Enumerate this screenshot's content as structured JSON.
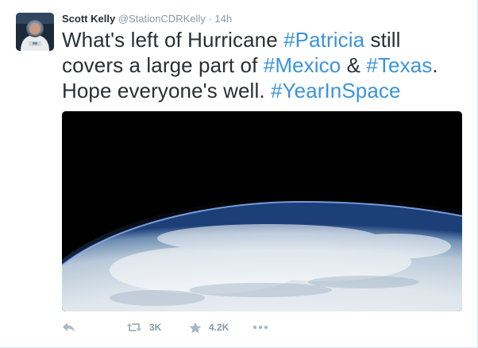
{
  "tweet": {
    "author_name": "Scott Kelly",
    "handle": "@StationCDRKelly",
    "separator": "·",
    "timestamp": "14h",
    "text": {
      "seg1": "What's left of Hurricane ",
      "tag1": "#Patricia",
      "seg2": " still covers a large part of ",
      "tag2": "#Mexico",
      "seg3": " & ",
      "tag3": "#Texas",
      "seg4": ". Hope everyone's well. ",
      "tag4": "#YearInSpace"
    }
  },
  "actions": {
    "reply": {
      "icon": "reply-icon"
    },
    "retweet": {
      "icon": "retweet-icon",
      "count": "3K"
    },
    "favorite": {
      "icon": "star-icon",
      "count": "4.2K"
    },
    "more": {
      "icon": "more-icon"
    }
  },
  "colors": {
    "hashtag": "#3b94d9",
    "secondary": "#8899a6",
    "text": "#292f33"
  }
}
